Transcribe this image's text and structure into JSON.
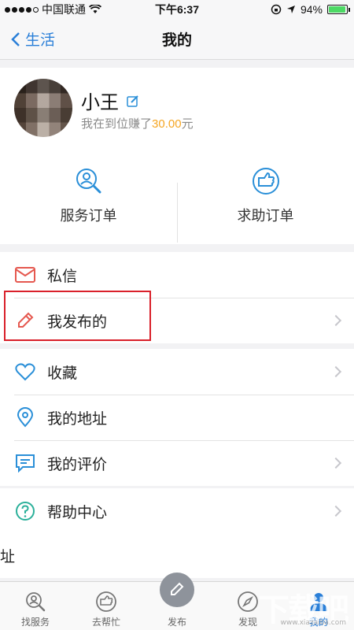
{
  "status_bar": {
    "carrier": "中国联通",
    "time": "下午6:37",
    "battery": "94%"
  },
  "nav": {
    "back_label": "生活",
    "title": "我的"
  },
  "profile": {
    "username": "小王",
    "earn_prefix": "我在到位赚了",
    "earn_amount": "30.00",
    "earn_suffix": "元"
  },
  "orders": [
    {
      "label": "服务订单",
      "icon": "search-person-icon"
    },
    {
      "label": "求助订单",
      "icon": "help-hand-icon"
    }
  ],
  "list_group1": [
    {
      "label": "私信",
      "icon": "mail-icon",
      "chevron": false
    },
    {
      "label": "我发布的",
      "icon": "pencil-icon",
      "chevron": true
    }
  ],
  "list_group2": [
    {
      "label": "收藏",
      "icon": "heart-icon",
      "chevron": true
    },
    {
      "label": "我的地址",
      "icon": "location-icon",
      "chevron": false
    },
    {
      "label": "我的评价",
      "icon": "comment-icon",
      "chevron": true
    }
  ],
  "list_group3": [
    {
      "label": "帮助中心",
      "icon": "question-icon",
      "chevron": true
    }
  ],
  "partial_row": "址",
  "tabs": [
    {
      "label": "找服务",
      "icon": "find-service-icon"
    },
    {
      "label": "去帮忙",
      "icon": "help-icon"
    },
    {
      "label": "发布",
      "icon": "publish-icon"
    },
    {
      "label": "发现",
      "icon": "compass-icon"
    },
    {
      "label": "我的",
      "icon": "profile-icon",
      "active": true
    }
  ],
  "watermark": "下载吧",
  "watermark_url": "www.xiazaiba.com",
  "colors": {
    "accent": "#2a7fd8",
    "amount": "#f5a623",
    "highlight": "#d9202a",
    "icon_red": "#e5584f",
    "icon_blue": "#2a8fd8",
    "icon_green": "#2bb09a"
  }
}
